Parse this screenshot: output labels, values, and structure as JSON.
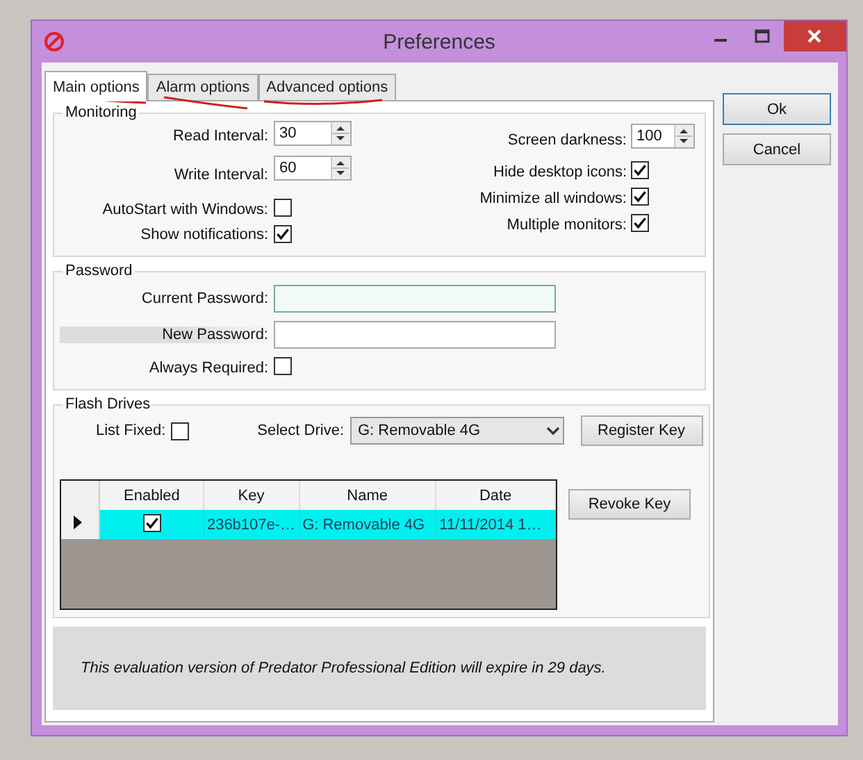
{
  "window": {
    "title": "Preferences"
  },
  "tabs": [
    {
      "label": "Main options",
      "selected": true
    },
    {
      "label": "Alarm options",
      "selected": false
    },
    {
      "label": "Advanced options",
      "selected": false
    }
  ],
  "buttons": [
    {
      "label": "Ok",
      "default": true
    },
    {
      "label": "Cancel",
      "default": false
    }
  ],
  "monitoring": {
    "title": "Monitoring",
    "spinners": [
      {
        "label": "Read Interval:",
        "value": "30"
      },
      {
        "label": "Write Interval:",
        "value": "60"
      }
    ],
    "left_checks": [
      {
        "label": "AutoStart with Windows:",
        "checked": false
      },
      {
        "label": "Show notifications:",
        "checked": true
      }
    ],
    "screen_darkness": {
      "label": "Screen darkness:",
      "value": "100"
    },
    "right_checks": [
      {
        "label": "Hide desktop icons:",
        "checked": true
      },
      {
        "label": "Minimize all windows:",
        "checked": true
      },
      {
        "label": "Multiple monitors:",
        "checked": true
      }
    ]
  },
  "password": {
    "title": "Password",
    "fields": [
      {
        "label": "Current Password:",
        "focused": true,
        "highlighted": false
      },
      {
        "label": "New Password:",
        "focused": false,
        "highlighted": true
      }
    ],
    "always_required": {
      "label": "Always Required:",
      "checked": false
    }
  },
  "flash_drives": {
    "title": "Flash Drives",
    "list_fixed": {
      "label": "List Fixed:",
      "checked": false
    },
    "select_drive": {
      "label": "Select Drive:",
      "value": "G: Removable 4G"
    },
    "register_button": "Register Key",
    "revoke_button": "Revoke Key",
    "table": {
      "columns": [
        "Enabled",
        "Key",
        "Name",
        "Date"
      ],
      "rows": [
        {
          "selected": true,
          "enabled": true,
          "key": "236b107e-…",
          "name": "G: Removable 4G",
          "date": "11/11/2014 1…"
        }
      ]
    }
  },
  "notice": "This evaluation version of Predator Professional Edition will expire in 29 days."
}
